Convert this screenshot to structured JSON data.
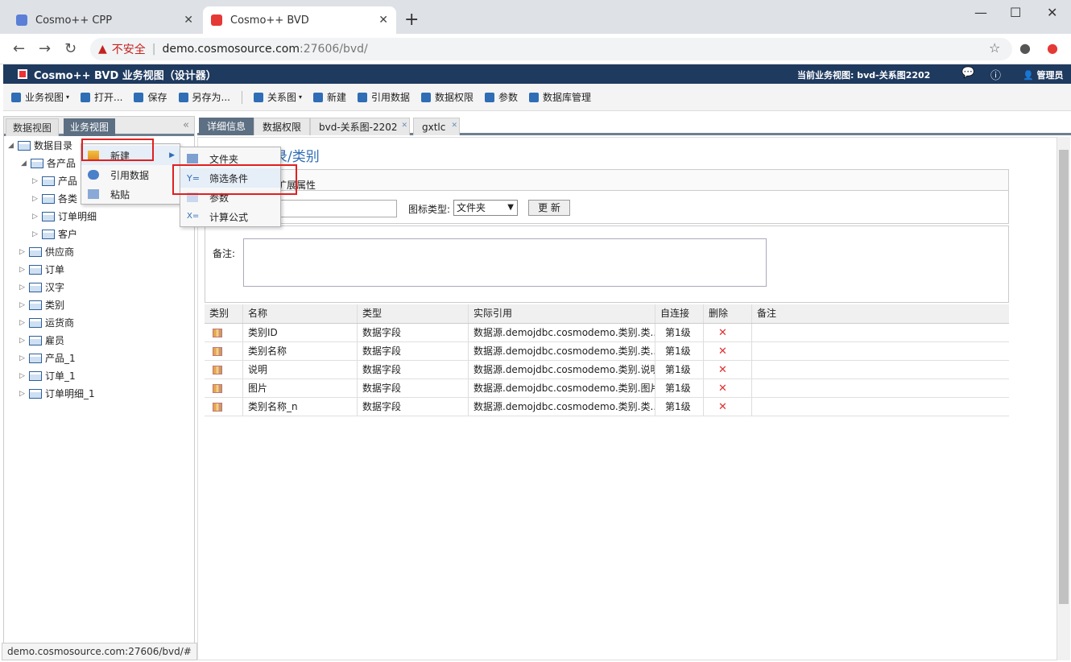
{
  "browser": {
    "tabs": [
      {
        "title": "Cosmo++ CPP",
        "active": false
      },
      {
        "title": "Cosmo++ BVD",
        "active": true
      }
    ],
    "new_tab": "+",
    "security_label": "不安全",
    "url_host": "demo.cosmosource.com",
    "url_path": ":27606/bvd/",
    "status_url": "demo.cosmosource.com:27606/bvd/#"
  },
  "app": {
    "title": "Cosmo++ BVD 业务视图（设计器）",
    "current_view": "当前业务视图: bvd-关系图2202",
    "user": "管理员"
  },
  "toolbar": {
    "items": [
      {
        "label": "业务视图",
        "caret": "▾"
      },
      {
        "label": "打开..."
      },
      {
        "label": "保存"
      },
      {
        "label": "另存为..."
      },
      {
        "label": "关系图",
        "caret": "▾"
      },
      {
        "label": "新建"
      },
      {
        "label": "引用数据"
      },
      {
        "label": "数据权限"
      },
      {
        "label": "参数"
      },
      {
        "label": "数据库管理"
      }
    ]
  },
  "left_panel": {
    "tabs": [
      "数据视图",
      "业务视图"
    ],
    "collapse": "«",
    "tree": [
      {
        "label": "数据目录"
      },
      {
        "label": "各产品"
      },
      {
        "label": "产品"
      },
      {
        "label": "各类"
      },
      {
        "label": "订单明细"
      },
      {
        "label": "客户"
      },
      {
        "label": "供应商"
      },
      {
        "label": "订单"
      },
      {
        "label": "汉字"
      },
      {
        "label": "类别"
      },
      {
        "label": "运货商"
      },
      {
        "label": "雇员"
      },
      {
        "label": "产品_1"
      },
      {
        "label": "订单_1"
      },
      {
        "label": "订单明细_1"
      }
    ]
  },
  "right_tabs": [
    "详细信息",
    "数据权限",
    "bvd-关系图-2202",
    "gxtlc"
  ],
  "detail": {
    "breadcrumb": "录/类别",
    "prop_tab": "扩展属性",
    "icon_type_label": "图标类型:",
    "icon_type_value": "文件夹",
    "update_button": "更 新",
    "note_label": "备注:"
  },
  "grid": {
    "columns": [
      "类别",
      "名称",
      "类型",
      "实际引用",
      "自连接",
      "删除",
      "备注"
    ],
    "rows": [
      {
        "name": "类别ID",
        "type": "数据字段",
        "ref": "数据源.demojdbc.cosmodemo.类别.类...",
        "level": "第1级",
        "del": "✕"
      },
      {
        "name": "类别名称",
        "type": "数据字段",
        "ref": "数据源.demojdbc.cosmodemo.类别.类...",
        "level": "第1级",
        "del": "✕"
      },
      {
        "name": "说明",
        "type": "数据字段",
        "ref": "数据源.demojdbc.cosmodemo.类别.说明",
        "level": "第1级",
        "del": "✕"
      },
      {
        "name": "图片",
        "type": "数据字段",
        "ref": "数据源.demojdbc.cosmodemo.类别.图片",
        "level": "第1级",
        "del": "✕"
      },
      {
        "name": "类别名称_n",
        "type": "数据字段",
        "ref": "数据源.demojdbc.cosmodemo.类别.类...",
        "level": "第1级",
        "del": "✕"
      }
    ]
  },
  "context_menu": {
    "items": [
      "新建",
      "引用数据",
      "粘贴"
    ],
    "submenu": [
      "文件夹",
      "筛选条件",
      "参数",
      "计算公式"
    ]
  }
}
